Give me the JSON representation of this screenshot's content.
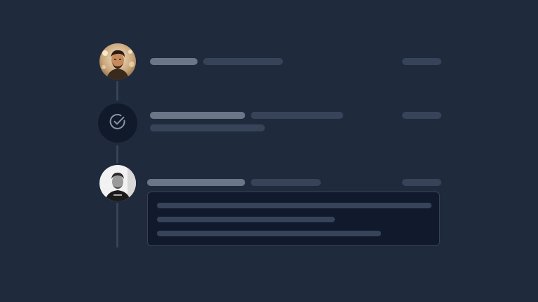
{
  "colors": {
    "background": "#1f2a3d",
    "bar_light": "#6b7689",
    "bar_dark": "#364359",
    "connector_line": "#364359",
    "check_circle_bg": "#111a2b",
    "check_icon": "#8a94a6",
    "comment_box_bg": "#111a2c",
    "comment_box_border": "#364359"
  },
  "timeline": {
    "events": [
      {
        "type": "user-activity",
        "avatar": "user-avatar-1",
        "icon": null
      },
      {
        "type": "status-change",
        "avatar": null,
        "icon": "check-circle-icon"
      },
      {
        "type": "comment",
        "avatar": "user-avatar-2",
        "icon": null
      }
    ]
  }
}
